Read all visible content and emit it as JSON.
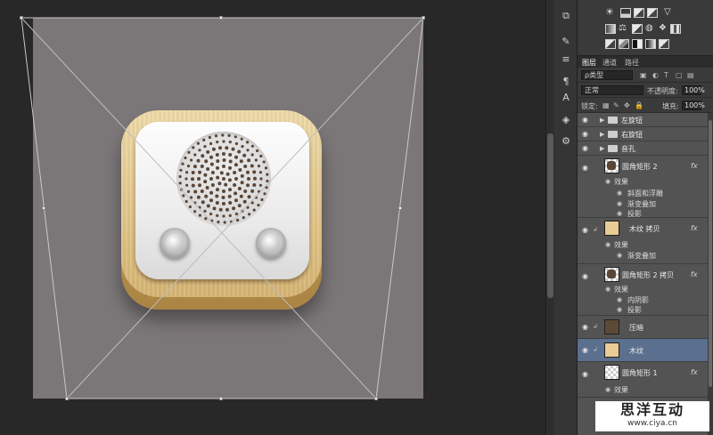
{
  "layers_panel": {
    "tabs": [
      "图层",
      "通道",
      "路径"
    ],
    "filter_kind": "ρ类型",
    "blend_mode": "正常",
    "opacity_label": "不透明度:",
    "opacity_value": "100%",
    "lock_label": "锁定:",
    "fill_label": "填充:",
    "fill_value": "100%",
    "fx_label": "fx",
    "layers": [
      {
        "name": "左旋钮",
        "type": "group"
      },
      {
        "name": "右旋钮",
        "type": "group"
      },
      {
        "name": "音孔",
        "type": "group"
      },
      {
        "name": "圆角矩形 2",
        "type": "shape",
        "fx": true,
        "effects_label": "效果",
        "effects": [
          "斜面和浮雕",
          "渐变叠加",
          "投影"
        ]
      },
      {
        "name": "木纹 拷贝",
        "type": "image",
        "fx": true,
        "effects_label": "效果",
        "effects": [
          "渐变叠加"
        ]
      },
      {
        "name": "圆角矩形 2 拷贝",
        "type": "shape",
        "fx": true,
        "effects_label": "效果",
        "effects": [
          "内阴影",
          "投影"
        ]
      },
      {
        "name": "压暗",
        "type": "fill"
      },
      {
        "name": "木纹",
        "type": "image",
        "selected": true
      },
      {
        "name": "圆角矩形 1",
        "type": "shape",
        "fx": true,
        "effects_label": "效果"
      }
    ]
  },
  "watermark": {
    "title": "思洋互动",
    "url": "www.ciya.cn"
  },
  "colors": {
    "canvas_bg": "#7b7677",
    "selected_layer": "#5b6f8f",
    "panel_bg": "#535353"
  }
}
